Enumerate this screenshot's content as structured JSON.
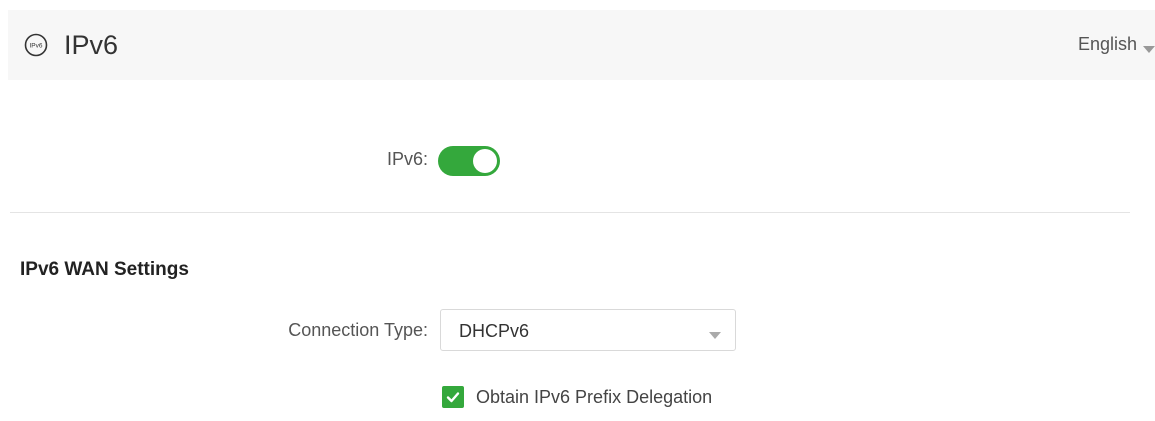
{
  "header": {
    "title": "IPv6",
    "icon": "ipv6-circle-icon",
    "icon_text": "IPv6",
    "language": "English"
  },
  "ipv6_toggle": {
    "label": "IPv6:",
    "enabled": true,
    "color": "#34a83c"
  },
  "wan_settings": {
    "title": "IPv6 WAN Settings",
    "connection_type_label": "Connection Type:",
    "connection_type_value": "DHCPv6",
    "prefix_delegation_label": "Obtain IPv6 Prefix Delegation",
    "prefix_delegation_checked": true
  }
}
